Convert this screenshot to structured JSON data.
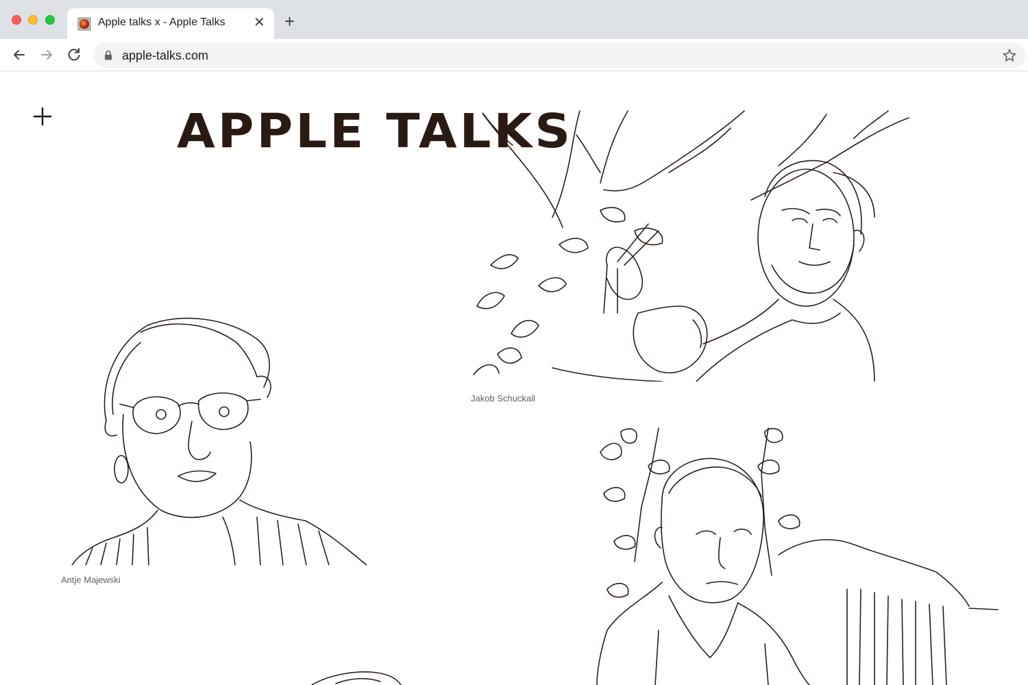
{
  "browser": {
    "tab": {
      "title": "Apple talks x - Apple Talks",
      "close_icon": "close-icon"
    },
    "new_tab_label": "+",
    "url": "apple-talks.com"
  },
  "page": {
    "menu_icon": "plus-icon",
    "logo": "APPLE TALKS",
    "portraits": [
      {
        "caption": "Jakob Schuckall"
      },
      {
        "caption": "Antje Majewski"
      }
    ]
  },
  "colors": {
    "ink": "#2b1d18",
    "chrome": "#dee1e6",
    "omnibox": "#f1f3f4"
  }
}
